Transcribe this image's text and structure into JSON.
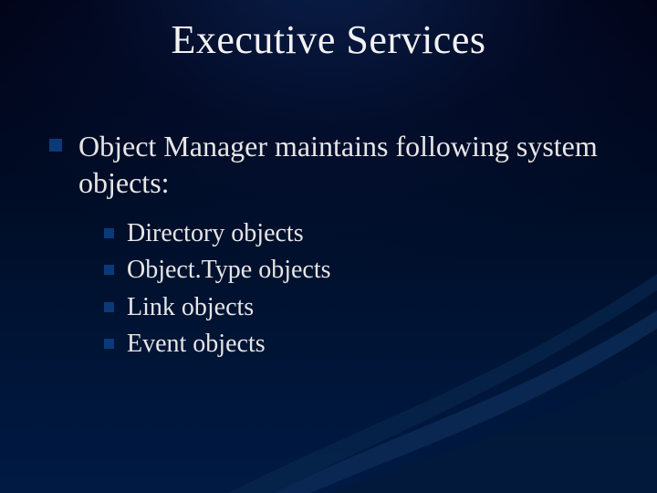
{
  "title": "Executive Services",
  "main_point": "Object Manager maintains following system objects:",
  "sub_points": [
    "Directory objects",
    "Object.Type objects",
    "Link objects",
    "Event objects"
  ]
}
